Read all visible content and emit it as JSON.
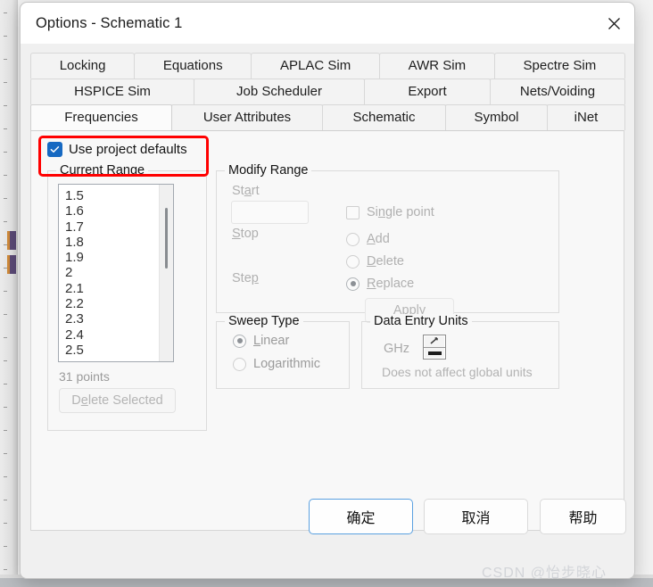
{
  "window": {
    "title": "Options - Schematic 1",
    "close_icon": "close-icon"
  },
  "tabs": {
    "row1": [
      {
        "label": "Locking",
        "active": false
      },
      {
        "label": "Equations",
        "active": false
      },
      {
        "label": "APLAC Sim",
        "active": false
      },
      {
        "label": "AWR Sim",
        "active": false
      },
      {
        "label": "Spectre Sim",
        "active": false
      }
    ],
    "row2": [
      {
        "label": "HSPICE Sim",
        "active": false
      },
      {
        "label": "Job Scheduler",
        "active": false
      },
      {
        "label": "Export",
        "active": false
      },
      {
        "label": "Nets/Voiding",
        "active": false
      }
    ],
    "row3": [
      {
        "label": "Frequencies",
        "active": true
      },
      {
        "label": "User Attributes",
        "active": false
      },
      {
        "label": "Schematic",
        "active": false
      },
      {
        "label": "Symbol",
        "active": false
      },
      {
        "label": "iNet",
        "active": false
      }
    ]
  },
  "frequencies": {
    "use_project_defaults": {
      "label_pre": "Use pro",
      "label_accel": "j",
      "label_post": "ect defaults",
      "checked": true
    },
    "current_range": {
      "title": "Current Range",
      "items": [
        "1.5",
        "1.6",
        "1.7",
        "1.8",
        "1.9",
        "2",
        "2.1",
        "2.2",
        "2.3",
        "2.4",
        "2.5"
      ],
      "points_label": "31 points",
      "delete_selected": {
        "pre": "D",
        "accel": "e",
        "post": "lete Selected",
        "enabled": false
      }
    },
    "modify_range": {
      "title": "Modify Range",
      "enabled": false,
      "start": {
        "label_pre": "St",
        "label_accel": "a",
        "label_post": "rt",
        "value": "",
        "placeholder": ""
      },
      "stop": {
        "label_pre": "",
        "label_accel": "S",
        "label_post": "top"
      },
      "step": {
        "label_pre": "Ste",
        "label_accel": "p",
        "label_post": ""
      },
      "single_point": {
        "pre": "Si",
        "accel": "n",
        "post": "gle point",
        "checked": false
      },
      "options": [
        {
          "pre": "",
          "accel": "A",
          "post": "dd",
          "selected": false
        },
        {
          "pre": "",
          "accel": "D",
          "post": "elete",
          "selected": false
        },
        {
          "pre": "",
          "accel": "R",
          "post": "eplace",
          "selected": true
        }
      ],
      "apply": {
        "pre": "Appl",
        "accel": "y",
        "post": ""
      }
    },
    "sweep_type": {
      "title": "Sweep Type",
      "options": [
        {
          "pre": "",
          "accel": "L",
          "post": "inear",
          "selected": true
        },
        {
          "pre": "Lo",
          "accel": "g",
          "post": "arithmic",
          "selected": false
        }
      ]
    },
    "data_entry_units": {
      "title": "Data Entry Units",
      "unit_value": "GHz",
      "spinner_icon": "spinner-up-down-icon",
      "note": "Does not affect global units"
    }
  },
  "buttons": {
    "ok": "确定",
    "cancel": "取消",
    "help": "帮助"
  },
  "annotation": {
    "type": "red-rectangle-highlight",
    "color": "#ff0000"
  },
  "watermark": "CSDN @怡步晓心"
}
